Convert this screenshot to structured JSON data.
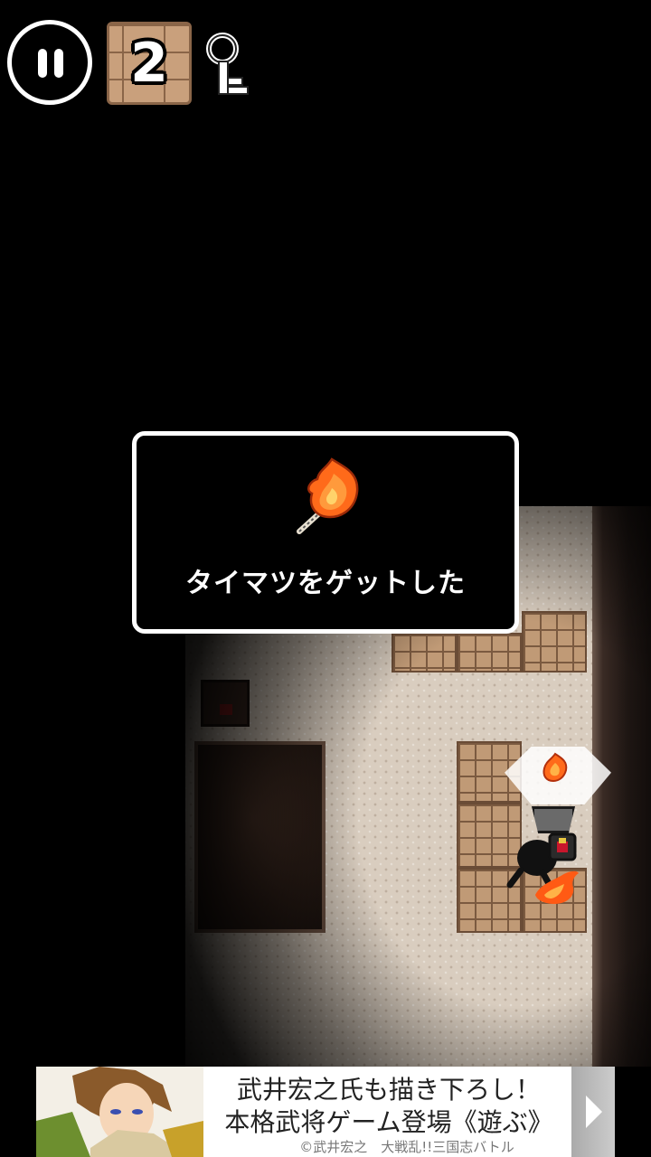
{
  "hud": {
    "pause_icon": "pause-icon",
    "floor_number": "2",
    "key_icon": "key-icon"
  },
  "dialog": {
    "item_icon": "torch-icon",
    "message": "タイマツをゲットした"
  },
  "map": {
    "items": [
      "torch-icon",
      "treasure-chest-icon",
      "fireball-icon"
    ]
  },
  "ad": {
    "line1": "武井宏之氏も描き下ろし！",
    "line2": "本格武将ゲーム登場《遊ぶ》",
    "credit": "©武井宏之　大戦乱!!三国志バトル",
    "arrow_icon": "chevron-right-icon"
  },
  "colors": {
    "brick": "#c09a76",
    "floor": "#d9cdbf",
    "fire": "#ff6a1a",
    "dialog_border": "#ffffff"
  }
}
